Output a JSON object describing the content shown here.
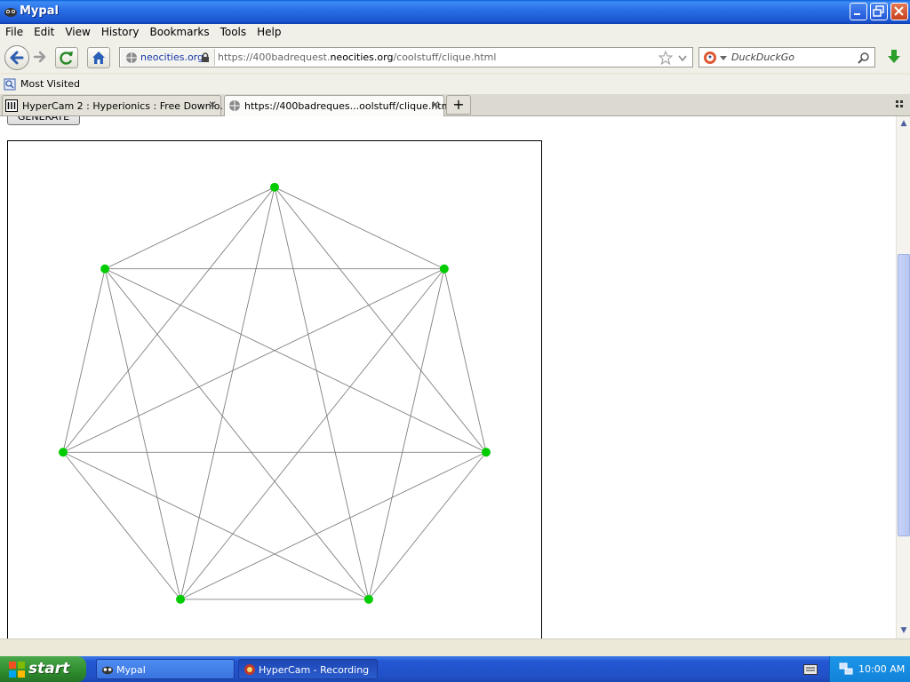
{
  "window": {
    "title": "Mypal"
  },
  "menu": {
    "file": "File",
    "edit": "Edit",
    "view": "View",
    "history": "History",
    "bookmarks": "Bookmarks",
    "tools": "Tools",
    "help": "Help"
  },
  "address": {
    "site_identity": "neocities.org",
    "url_prefix": "https://400badrequest.",
    "url_domain": "neocities.org",
    "url_path": "/coolstuff/clique.html"
  },
  "search": {
    "placeholder": "DuckDuckGo"
  },
  "bookmarks_bar": {
    "most_visited": "Most Visited"
  },
  "tabs": [
    {
      "label": "HyperCam 2 : Hyperionics : Free Downlo...",
      "active": false
    },
    {
      "label": "https://400badreques...oolstuff/clique.html",
      "active": true
    }
  ],
  "page": {
    "generate_button": "GENERATE",
    "graph": {
      "node_color": "#00cc00",
      "edge_color": "#808080",
      "node_count": 7,
      "complete_graph": true
    }
  },
  "taskbar": {
    "start": "start",
    "tasks": [
      {
        "label": "Mypal"
      },
      {
        "label": "HyperCam - Recording"
      }
    ],
    "clock": "10:00 AM"
  }
}
